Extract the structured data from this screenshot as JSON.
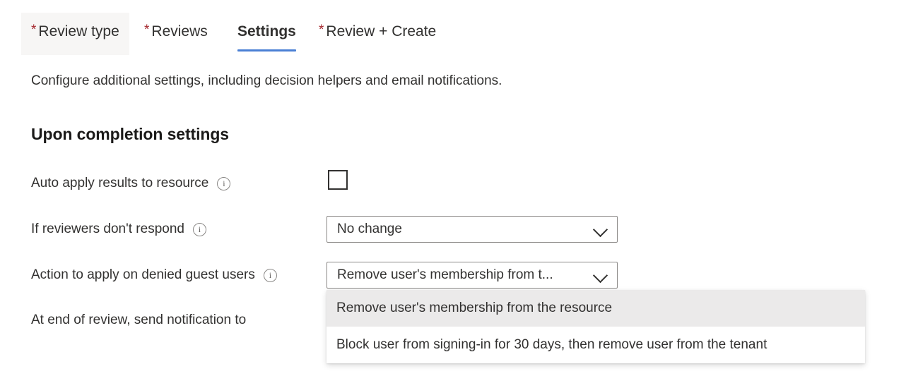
{
  "tabs": [
    {
      "required": "*",
      "label": "Review type",
      "state": "hovered"
    },
    {
      "required": "*",
      "label": "Reviews",
      "state": "default"
    },
    {
      "required": "",
      "label": "Settings",
      "state": "active"
    },
    {
      "required": "*",
      "label": "Review + Create",
      "state": "default"
    }
  ],
  "page": {
    "description": "Configure additional settings, including decision helpers and email notifications.",
    "section_heading": "Upon completion settings"
  },
  "form": {
    "auto_apply": {
      "label": "Auto apply results to resource",
      "info_icon": "info-icon",
      "checked": false
    },
    "no_respond": {
      "label": "If reviewers don't respond",
      "info_icon": "info-icon",
      "value": "No change",
      "chevron_icon": "chevron-down-icon"
    },
    "denied_guest": {
      "label": "Action to apply on denied guest users",
      "info_icon": "info-icon",
      "value": "Remove user's membership from t...",
      "chevron_icon": "chevron-down-icon",
      "options": [
        {
          "label": "Remove user's membership from the resource",
          "selected": true
        },
        {
          "label": "Block user from signing-in for 30 days, then remove user from the tenant",
          "selected": false
        }
      ]
    },
    "notification": {
      "label": "At end of review, send notification to"
    }
  },
  "colors": {
    "accent": "#4a7fd4",
    "required_asterisk": "#a4262c",
    "text": "#323130",
    "hover_bg": "#f7f6f5",
    "option_selected_bg": "#ebeaea"
  }
}
